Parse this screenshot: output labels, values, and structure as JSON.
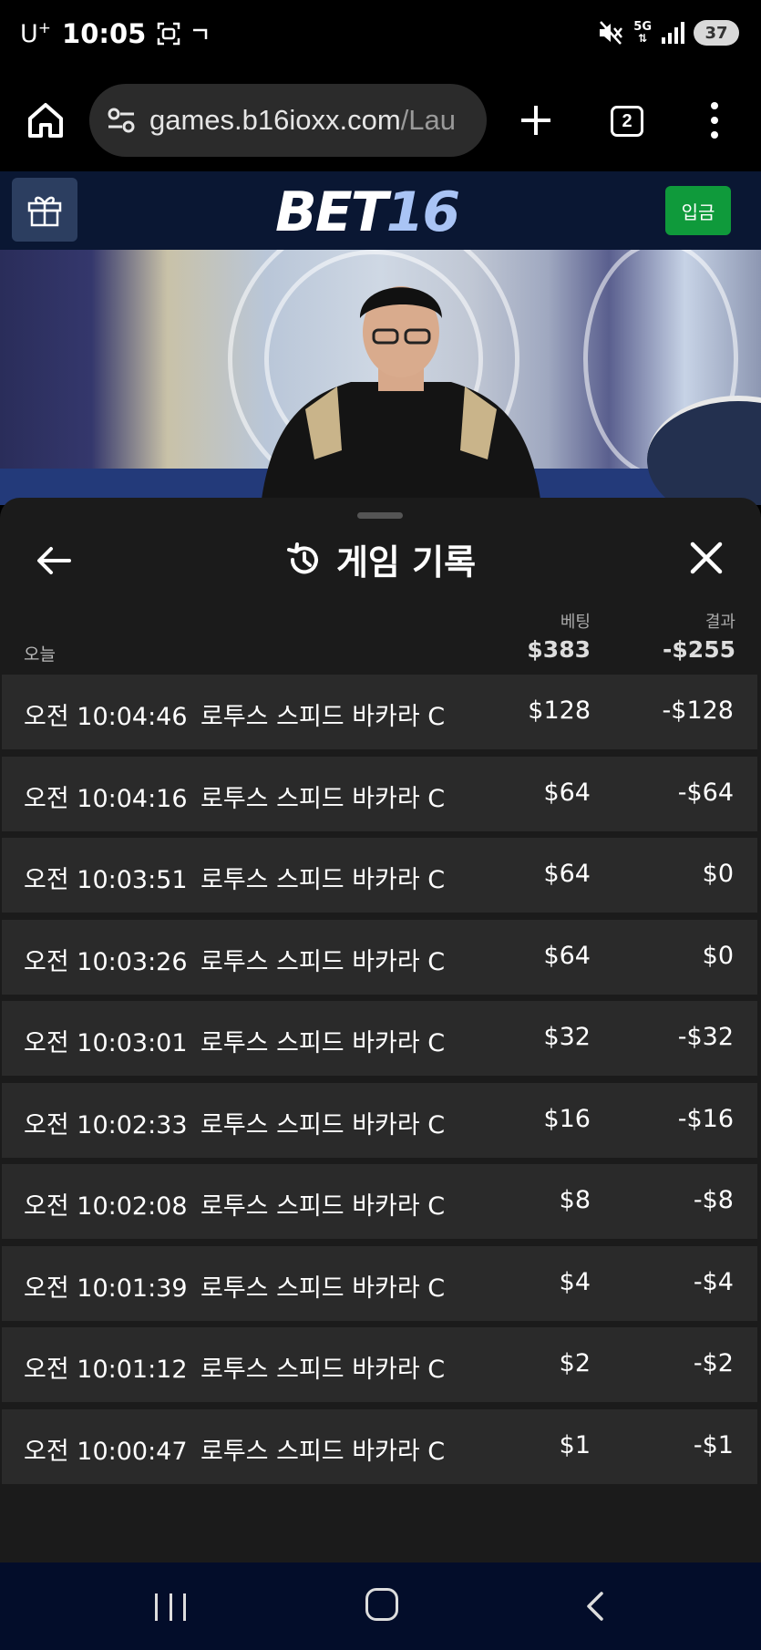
{
  "status_bar": {
    "carrier": "U",
    "carrier_sup": "+",
    "time": "10:05",
    "network": "5G",
    "battery": "37"
  },
  "browser": {
    "url_host": "games.b16ioxx.com",
    "url_path": "/Lau",
    "tab_count": "2"
  },
  "site": {
    "logo_bet": "BET",
    "logo_num": "16",
    "deposit_label": "입금"
  },
  "history": {
    "title": "게임 기록",
    "col_bet": "베팅",
    "col_result": "결과",
    "today_label": "오늘",
    "total_bet": "$383",
    "total_result": "-$255",
    "rows": [
      {
        "time": "오전 10:04:46",
        "game": "로투스 스피드 바카라 C",
        "bet": "$128",
        "result": "-$128"
      },
      {
        "time": "오전 10:04:16",
        "game": "로투스 스피드 바카라 C",
        "bet": "$64",
        "result": "-$64"
      },
      {
        "time": "오전 10:03:51",
        "game": "로투스 스피드 바카라 C",
        "bet": "$64",
        "result": "$0"
      },
      {
        "time": "오전 10:03:26",
        "game": "로투스 스피드 바카라 C",
        "bet": "$64",
        "result": "$0"
      },
      {
        "time": "오전 10:03:01",
        "game": "로투스 스피드 바카라 C",
        "bet": "$32",
        "result": "-$32"
      },
      {
        "time": "오전 10:02:33",
        "game": "로투스 스피드 바카라 C",
        "bet": "$16",
        "result": "-$16"
      },
      {
        "time": "오전 10:02:08",
        "game": "로투스 스피드 바카라 C",
        "bet": "$8",
        "result": "-$8"
      },
      {
        "time": "오전 10:01:39",
        "game": "로투스 스피드 바카라 C",
        "bet": "$4",
        "result": "-$4"
      },
      {
        "time": "오전 10:01:12",
        "game": "로투스 스피드 바카라 C",
        "bet": "$2",
        "result": "-$2"
      },
      {
        "time": "오전 10:00:47",
        "game": "로투스 스피드 바카라 C",
        "bet": "$1",
        "result": "-$1"
      }
    ]
  },
  "colors": {
    "header_bg": "#0a1733",
    "deposit_green": "#0f9a3b",
    "logo_accent": "#a9c4f5",
    "sheet_bg": "#1b1b1b",
    "row_bg": "#2a2a2a"
  }
}
